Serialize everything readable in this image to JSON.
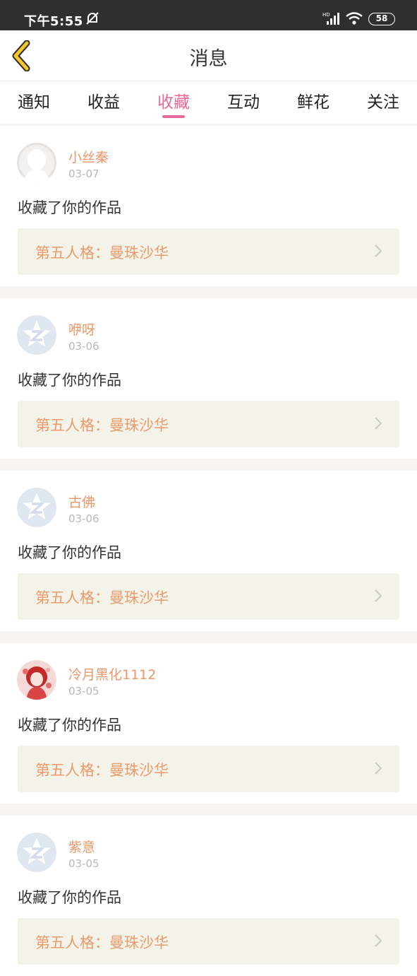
{
  "status": {
    "time": "下午5:55",
    "battery": "58",
    "network_label": "HD"
  },
  "header": {
    "title": "消息"
  },
  "tabs": [
    {
      "label": "通知"
    },
    {
      "label": "收益"
    },
    {
      "label": "收藏",
      "active": true
    },
    {
      "label": "互动"
    },
    {
      "label": "鲜花"
    },
    {
      "label": "关注"
    }
  ],
  "items": [
    {
      "name": "小丝秦",
      "date": "03-07",
      "action": "收藏了你的作品",
      "work": "第五人格：曼珠沙华",
      "avatar": "white-silhouette-avatar"
    },
    {
      "name": "咿呀",
      "date": "03-06",
      "action": "收藏了你的作品",
      "work": "第五人格：曼珠沙华",
      "avatar": "default-star-avatar"
    },
    {
      "name": "古佛",
      "date": "03-06",
      "action": "收藏了你的作品",
      "work": "第五人格：曼珠沙华",
      "avatar": "default-star-avatar"
    },
    {
      "name": "冷月黑化1112",
      "date": "03-05",
      "action": "收藏了你的作品",
      "work": "第五人格：曼珠沙华",
      "avatar": "anime-avatar"
    },
    {
      "name": "紫意",
      "date": "03-05",
      "action": "收藏了你的作品",
      "work": "第五人格：曼珠沙华",
      "avatar": "default-star-avatar"
    }
  ],
  "colors": {
    "accent": "#e8689b",
    "username": "#e8976b",
    "work_title": "#eb9b6a",
    "work_bg": "#f4f3ea",
    "back_arrow": "#f5c52c"
  }
}
